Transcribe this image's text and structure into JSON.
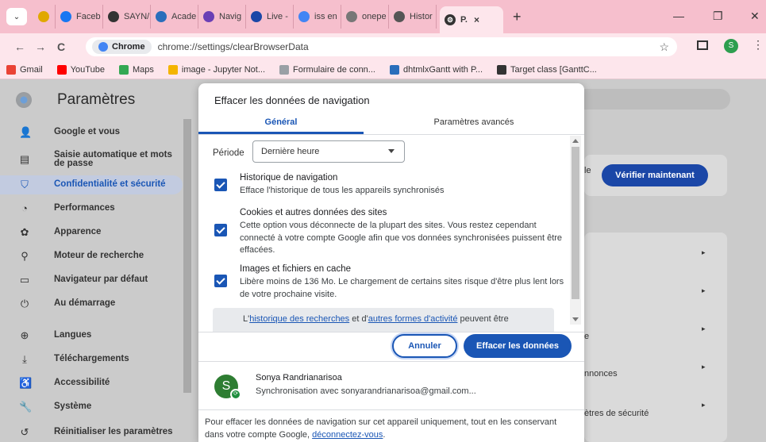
{
  "browser": {
    "tabs": [
      {
        "label": "",
        "icon": "clip-icon",
        "color": "#e0a800"
      },
      {
        "label": "Faceb",
        "icon": "facebook-icon",
        "color": "#1877f2"
      },
      {
        "label": "SAYN/",
        "icon": "circle-slash-icon",
        "color": "#333333"
      },
      {
        "label": "Acade",
        "icon": "academia-icon",
        "color": "#2a6ebb"
      },
      {
        "label": "Navig",
        "icon": "flag-icon",
        "color": "#6a3fb5"
      },
      {
        "label": "Live -",
        "icon": "live-icon",
        "color": "#1b47a7"
      },
      {
        "label": "iss en",
        "icon": "google-icon",
        "color": "#4285f4"
      },
      {
        "label": "onepe",
        "icon": "onepage-icon",
        "color": "#777777"
      },
      {
        "label": "Histor",
        "icon": "history-icon",
        "color": "#555555"
      }
    ],
    "active_tab": {
      "label": "P.",
      "close": "×"
    },
    "new_tab": "+",
    "window": {
      "minimize": "—",
      "restore": "❐",
      "close": "✕"
    },
    "nav": {
      "back": "←",
      "forward": "→",
      "reload": "C"
    },
    "omnibox": {
      "chip": "Chrome",
      "url": "chrome://settings/clearBrowserData",
      "star": "☆"
    },
    "profile_initial": "S",
    "menu": "⋮",
    "bookmarks": [
      {
        "label": "Gmail",
        "color": "#ea4335"
      },
      {
        "label": "YouTube",
        "color": "#ff0000"
      },
      {
        "label": "Maps",
        "color": "#34a853"
      },
      {
        "label": "image - Jupyter Not...",
        "color": "#f4b400"
      },
      {
        "label": "Formulaire de conn...",
        "color": "#9aa0a6"
      },
      {
        "label": "dhtmlxGantt with P...",
        "color": "#2a6ebb"
      },
      {
        "label": "Target class [GanttC...",
        "color": "#333333"
      }
    ]
  },
  "settings": {
    "title": "Paramètres",
    "sidebar": [
      {
        "label": "Google et vous",
        "icon": "person-icon",
        "glyph": "👤"
      },
      {
        "label": "Saisie automatique et mots de passe",
        "icon": "clipboard-icon",
        "glyph": "▤"
      },
      {
        "label": "Confidentialité et sécurité",
        "icon": "shield-icon",
        "glyph": "⛉",
        "active": true
      },
      {
        "label": "Performances",
        "icon": "gauge-icon",
        "glyph": "◔"
      },
      {
        "label": "Apparence",
        "icon": "palette-icon",
        "glyph": "✿"
      },
      {
        "label": "Moteur de recherche",
        "icon": "search-icon",
        "glyph": "⚲"
      },
      {
        "label": "Navigateur par défaut",
        "icon": "browser-icon",
        "glyph": "▭"
      },
      {
        "label": "Au démarrage",
        "icon": "power-icon",
        "glyph": "⏻"
      },
      {
        "label": "Langues",
        "icon": "globe-icon",
        "glyph": "⊕"
      },
      {
        "label": "Téléchargements",
        "icon": "download-icon",
        "glyph": "⤓"
      },
      {
        "label": "Accessibilité",
        "icon": "accessibility-icon",
        "glyph": "♿"
      },
      {
        "label": "Système",
        "icon": "wrench-icon",
        "glyph": "🔧"
      },
      {
        "label": "Réinitialiser les paramètres",
        "icon": "reset-icon",
        "glyph": "↺"
      }
    ],
    "background": {
      "verify_label": "Vérifier maintenant",
      "partial_le": "le",
      "partial_e": "e",
      "partial_annonces": "nnonces",
      "partial_security": "ètres de sécurité"
    }
  },
  "dialog": {
    "title": "Effacer les données de navigation",
    "tabs": {
      "general": "Général",
      "advanced": "Paramètres avancés"
    },
    "period": {
      "label": "Période",
      "value": "Dernière heure"
    },
    "options": [
      {
        "title": "Historique de navigation",
        "desc": "Efface l'historique de tous les appareils synchronisés",
        "checked": true
      },
      {
        "title": "Cookies et autres données des sites",
        "desc": "Cette option vous déconnecte de la plupart des sites. Vous restez cependant connecté à votre compte Google afin que vos données synchronisées puissent être effacées.",
        "checked": true
      },
      {
        "title": "Images et fichiers en cache",
        "desc": "Libère moins de 136 Mo. Le chargement de certains sites risque d'être plus lent lors de votre prochaine visite.",
        "checked": true
      }
    ],
    "info": {
      "prefix": "L'",
      "link1": "historique des recherches",
      "middle": " et d'",
      "link2": "autres formes d'activité",
      "suffix": " peuvent être"
    },
    "buttons": {
      "cancel": "Annuler",
      "clear": "Effacer les données"
    },
    "sync": {
      "avatar": "S",
      "name": "Sonya Randrianarisoa",
      "email": "Synchronisation avec sonyarandrianarisoa@gmail.com..."
    },
    "footer": {
      "text": "Pour effacer les données de navigation sur cet appareil uniquement, tout en les conservant dans votre compte Google, ",
      "link": "déconnectez-vous",
      "end": "."
    }
  }
}
